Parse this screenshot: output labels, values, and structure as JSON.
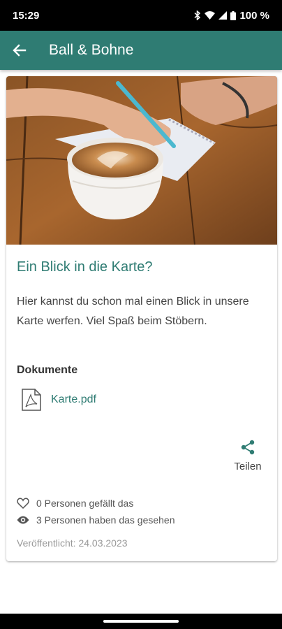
{
  "status_bar": {
    "time": "15:29",
    "battery": "100 %"
  },
  "app_bar": {
    "title": "Ball & Bohne"
  },
  "post": {
    "title": "Ein Blick in die Karte?",
    "description": "Hier kannst du schon mal einen Blick in unsere Karte werfen. Viel Spaß beim Stöbern.",
    "documents_label": "Dokumente",
    "documents": [
      {
        "name": "Karte.pdf",
        "icon": "pdf-icon"
      }
    ],
    "share_label": "Teilen",
    "likes_text": "0 Personen gefällt das",
    "views_text": "3 Personen haben das gesehen",
    "published": "Veröffentlicht: 24.03.2023"
  },
  "colors": {
    "accent": "#2f7c73"
  }
}
